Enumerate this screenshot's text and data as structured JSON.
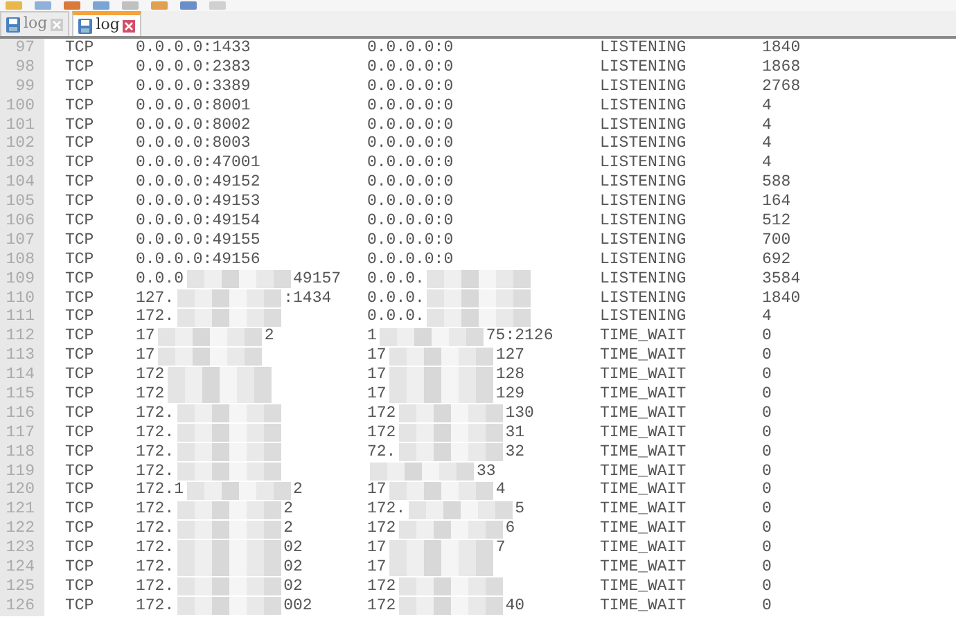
{
  "tabs": [
    {
      "label": "log",
      "selected": false
    },
    {
      "label": "log",
      "selected": true
    }
  ],
  "lines": [
    {
      "number": "97",
      "proto": "TCP",
      "local": {
        "prefix": "0.0.0.0:1433"
      },
      "foreign": {
        "prefix": "0.0.0.0:0"
      },
      "state": "LISTENING",
      "pid": "1840"
    },
    {
      "number": "98",
      "proto": "TCP",
      "local": {
        "prefix": "0.0.0.0:2383"
      },
      "foreign": {
        "prefix": "0.0.0.0:0"
      },
      "state": "LISTENING",
      "pid": "1868"
    },
    {
      "number": "99",
      "proto": "TCP",
      "local": {
        "prefix": "0.0.0.0:3389"
      },
      "foreign": {
        "prefix": "0.0.0.0:0"
      },
      "state": "LISTENING",
      "pid": "2768"
    },
    {
      "number": "100",
      "proto": "TCP",
      "local": {
        "prefix": "0.0.0.0:8001"
      },
      "foreign": {
        "prefix": "0.0.0.0:0"
      },
      "state": "LISTENING",
      "pid": "4"
    },
    {
      "number": "101",
      "proto": "TCP",
      "local": {
        "prefix": "0.0.0.0:8002"
      },
      "foreign": {
        "prefix": "0.0.0.0:0"
      },
      "state": "LISTENING",
      "pid": "4"
    },
    {
      "number": "102",
      "proto": "TCP",
      "local": {
        "prefix": "0.0.0.0:8003"
      },
      "foreign": {
        "prefix": "0.0.0.0:0"
      },
      "state": "LISTENING",
      "pid": "4"
    },
    {
      "number": "103",
      "proto": "TCP",
      "local": {
        "prefix": "0.0.0.0:47001"
      },
      "foreign": {
        "prefix": "0.0.0.0:0"
      },
      "state": "LISTENING",
      "pid": "4"
    },
    {
      "number": "104",
      "proto": "TCP",
      "local": {
        "prefix": "0.0.0.0:49152"
      },
      "foreign": {
        "prefix": "0.0.0.0:0"
      },
      "state": "LISTENING",
      "pid": "588"
    },
    {
      "number": "105",
      "proto": "TCP",
      "local": {
        "prefix": "0.0.0.0:49153"
      },
      "foreign": {
        "prefix": "0.0.0.0:0"
      },
      "state": "LISTENING",
      "pid": "164"
    },
    {
      "number": "106",
      "proto": "TCP",
      "local": {
        "prefix": "0.0.0.0:49154"
      },
      "foreign": {
        "prefix": "0.0.0.0:0"
      },
      "state": "LISTENING",
      "pid": "512"
    },
    {
      "number": "107",
      "proto": "TCP",
      "local": {
        "prefix": "0.0.0.0:49155"
      },
      "foreign": {
        "prefix": "0.0.0.0:0"
      },
      "state": "LISTENING",
      "pid": "700"
    },
    {
      "number": "108",
      "proto": "TCP",
      "local": {
        "prefix": "0.0.0.0:49156"
      },
      "foreign": {
        "prefix": "0.0.0.0:0"
      },
      "state": "LISTENING",
      "pid": "692"
    },
    {
      "number": "109",
      "proto": "TCP",
      "local": {
        "prefix": "0.0.0",
        "suffix": "49157",
        "redacted": true
      },
      "foreign": {
        "prefix": "0.0.0.",
        "redacted": true
      },
      "state": "LISTENING",
      "pid": "3584"
    },
    {
      "number": "110",
      "proto": "TCP",
      "local": {
        "prefix": "127.",
        "suffix": ":1434",
        "redacted": true
      },
      "foreign": {
        "prefix": "0.0.0.",
        "redacted": true
      },
      "state": "LISTENING",
      "pid": "1840"
    },
    {
      "number": "111",
      "proto": "TCP",
      "local": {
        "prefix": "172.",
        "redacted": true
      },
      "foreign": {
        "prefix": "0.0.0.",
        "redacted": true
      },
      "state": "LISTENING",
      "pid": "4"
    },
    {
      "number": "112",
      "proto": "TCP",
      "local": {
        "prefix": "17",
        "suffix": "2",
        "redacted": true
      },
      "foreign": {
        "prefix": "1",
        "suffix": "75:2126",
        "redacted": true
      },
      "state": "TIME_WAIT",
      "pid": "0"
    },
    {
      "number": "113",
      "proto": "TCP",
      "local": {
        "prefix": "17",
        "redacted": true
      },
      "foreign": {
        "prefix": "17",
        "suffix": "127",
        "redacted": true
      },
      "state": "TIME_WAIT",
      "pid": "0"
    },
    {
      "number": "114",
      "proto": "TCP",
      "local": {
        "prefix": "172",
        "redacted": true
      },
      "foreign": {
        "prefix": "17",
        "suffix": "128",
        "redacted": true
      },
      "state": "TIME_WAIT",
      "pid": "0"
    },
    {
      "number": "115",
      "proto": "TCP",
      "local": {
        "prefix": "172",
        "redacted": true
      },
      "foreign": {
        "prefix": "17",
        "suffix": "129",
        "redacted": true
      },
      "state": "TIME_WAIT",
      "pid": "0"
    },
    {
      "number": "116",
      "proto": "TCP",
      "local": {
        "prefix": "172.",
        "redacted": true
      },
      "foreign": {
        "prefix": "172",
        "suffix": "130",
        "redacted": true
      },
      "state": "TIME_WAIT",
      "pid": "0"
    },
    {
      "number": "117",
      "proto": "TCP",
      "local": {
        "prefix": "172.",
        "redacted": true
      },
      "foreign": {
        "prefix": "172",
        "suffix": "31",
        "redacted": true
      },
      "state": "TIME_WAIT",
      "pid": "0"
    },
    {
      "number": "118",
      "proto": "TCP",
      "local": {
        "prefix": "172.",
        "redacted": true
      },
      "foreign": {
        "prefix": "72.",
        "suffix": "32",
        "redacted": true
      },
      "state": "TIME_WAIT",
      "pid": "0"
    },
    {
      "number": "119",
      "proto": "TCP",
      "local": {
        "prefix": "172.",
        "redacted": true
      },
      "foreign": {
        "suffix": "33",
        "redacted": true
      },
      "state": "TIME_WAIT",
      "pid": "0"
    },
    {
      "number": "120",
      "proto": "TCP",
      "local": {
        "prefix": "172.1",
        "suffix": "2",
        "redacted": true
      },
      "foreign": {
        "prefix": "17",
        "suffix": "4",
        "redacted": true
      },
      "state": "TIME_WAIT",
      "pid": "0"
    },
    {
      "number": "121",
      "proto": "TCP",
      "local": {
        "prefix": "172.",
        "suffix": "2",
        "redacted": true
      },
      "foreign": {
        "prefix": "172.",
        "suffix": "5",
        "redacted": true
      },
      "state": "TIME_WAIT",
      "pid": "0"
    },
    {
      "number": "122",
      "proto": "TCP",
      "local": {
        "prefix": "172.",
        "suffix": "2",
        "redacted": true
      },
      "foreign": {
        "prefix": "172",
        "suffix": "6",
        "redacted": true
      },
      "state": "TIME_WAIT",
      "pid": "0"
    },
    {
      "number": "123",
      "proto": "TCP",
      "local": {
        "prefix": "172.",
        "suffix": "02",
        "redacted": true
      },
      "foreign": {
        "prefix": "17",
        "suffix": "7",
        "redacted": true
      },
      "state": "TIME_WAIT",
      "pid": "0"
    },
    {
      "number": "124",
      "proto": "TCP",
      "local": {
        "prefix": "172.",
        "suffix": "02",
        "redacted": true
      },
      "foreign": {
        "prefix": "17",
        "redacted": true
      },
      "state": "TIME_WAIT",
      "pid": "0"
    },
    {
      "number": "125",
      "proto": "TCP",
      "local": {
        "prefix": "172.",
        "suffix": "02",
        "redacted": true
      },
      "foreign": {
        "prefix": "172",
        "redacted": true
      },
      "state": "TIME_WAIT",
      "pid": "0"
    },
    {
      "number": "126",
      "proto": "TCP",
      "local": {
        "prefix": "172.",
        "suffix": "002",
        "redacted": true
      },
      "foreign": {
        "prefix": "172",
        "suffix": "40",
        "redacted": true
      },
      "state": "TIME_WAIT",
      "pid": "0"
    }
  ]
}
